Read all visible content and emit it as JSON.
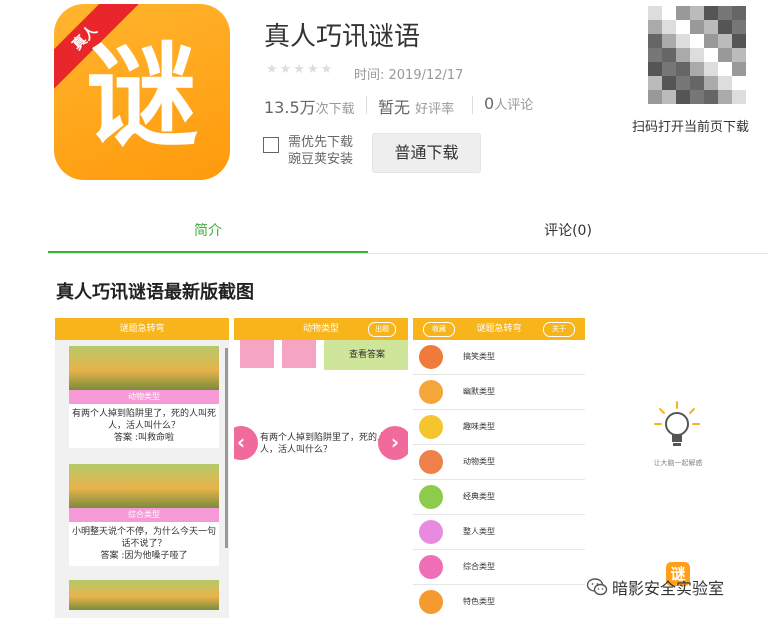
{
  "app": {
    "icon_glyph": "谜",
    "icon_ribbon": "真人",
    "name": "真人巧讯谜语",
    "stars": "★★★★★",
    "date": "时间: 2019/12/17",
    "downloads_value": "13.5万",
    "downloads_unit": "次下载",
    "rating_value": "暂无",
    "rating_unit": "好评率",
    "reviews_value": "0",
    "reviews_unit": "人评论",
    "pref_line1": "需优先下载",
    "pref_line2": "豌豆荚安装",
    "download_button": "普通下载",
    "accent_color": "#3cb03c"
  },
  "qr": {
    "label": "扫码打开当前页下载"
  },
  "tabs": [
    {
      "label": "简介",
      "active": true
    },
    {
      "label": "评论(0)",
      "active": false
    }
  ],
  "section_title": "真人巧讯谜语最新版截图",
  "shot1": {
    "topbar": "谜题急转弯",
    "cards": [
      {
        "tag": "动物类型",
        "question": "有两个人掉到陷阱里了，死的人叫死人，活人叫什么？",
        "answer": "答案 :叫救命啦"
      },
      {
        "tag": "综合类型",
        "question": "小明整天说个不停，为什么今天一句话不说了？",
        "answer": "答案 :因为他嗓子哑了"
      }
    ]
  },
  "shot2": {
    "topbar": "动物类型",
    "topic_button": "出题",
    "answer_button": "查看答案",
    "question": "有两个人掉到陷阱里了，死的人叫死人，活人叫什么？",
    "prev": "‹",
    "next": "›"
  },
  "shot3": {
    "topbar": "谜题急转弯",
    "left_pill": "收藏",
    "right_pill": "关于",
    "categories": [
      {
        "label": "搞笑类型",
        "color": "#f07a3c"
      },
      {
        "label": "幽默类型",
        "color": "#f5a63a"
      },
      {
        "label": "趣味类型",
        "color": "#f5c52e"
      },
      {
        "label": "动物类型",
        "color": "#f0804a"
      },
      {
        "label": "经典类型",
        "color": "#8ccc4a"
      },
      {
        "label": "整人类型",
        "color": "#e88be0"
      },
      {
        "label": "综合类型",
        "color": "#ef6fb6"
      },
      {
        "label": "特色类型",
        "color": "#f59a2e"
      }
    ]
  },
  "promo": {
    "slogan": "让大脑一起解惑",
    "mini_icon": "谜"
  },
  "watermark": "暗影安全实验室"
}
